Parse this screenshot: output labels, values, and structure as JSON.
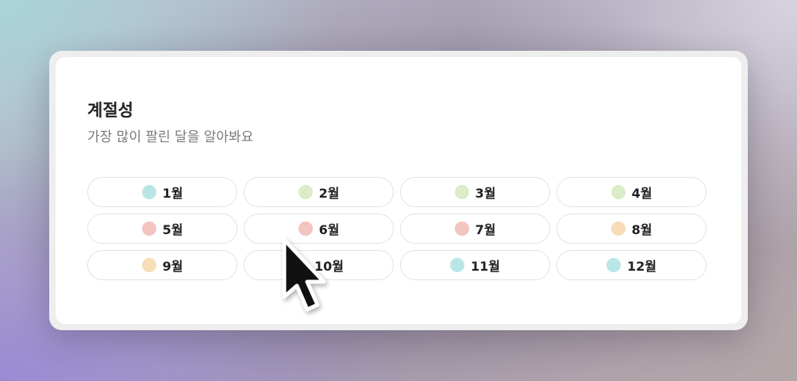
{
  "card": {
    "title": "계절성",
    "subtitle": "가장 많이 팔린 달을 알아봐요"
  },
  "months": [
    {
      "label": "1월",
      "color": "#b9e6e5"
    },
    {
      "label": "2월",
      "color": "#dcecc9"
    },
    {
      "label": "3월",
      "color": "#dcecc9"
    },
    {
      "label": "4월",
      "color": "#dcecc9"
    },
    {
      "label": "5월",
      "color": "#f3c4c0"
    },
    {
      "label": "6월",
      "color": "#f3c4c0"
    },
    {
      "label": "7월",
      "color": "#f3c4c0"
    },
    {
      "label": "8월",
      "color": "#f8ddb8"
    },
    {
      "label": "9월",
      "color": "#f8ddb8"
    },
    {
      "label": "10월",
      "color": "#f8ddb8"
    },
    {
      "label": "11월",
      "color": "#b9e6e5"
    },
    {
      "label": "12월",
      "color": "#b9e6e5"
    }
  ],
  "cursor": {
    "icon": "mouse-pointer-icon"
  }
}
